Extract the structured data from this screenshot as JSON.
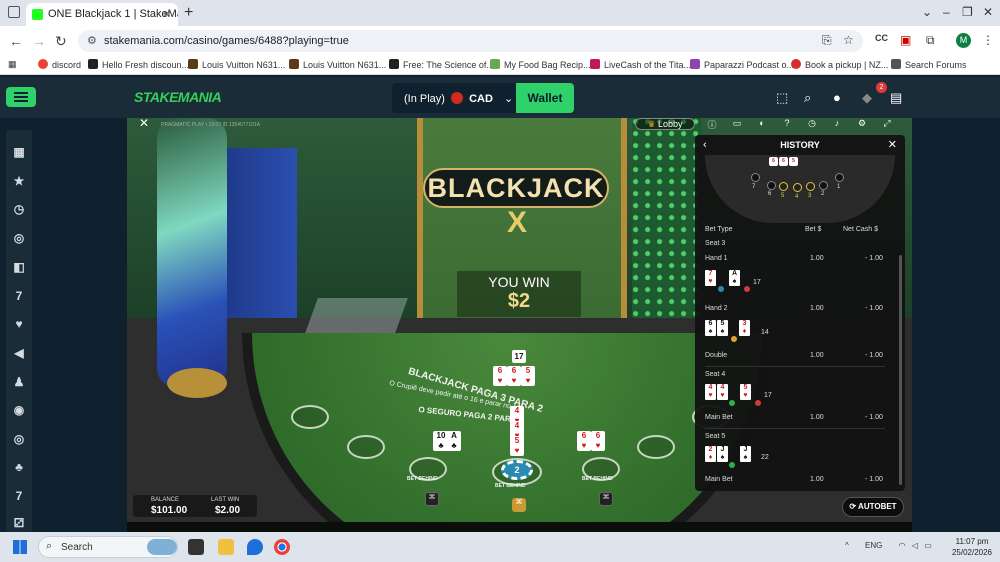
{
  "browser": {
    "tab_title": "ONE Blackjack 1 | StakeMa",
    "tab_close": "×",
    "new_tab": "+",
    "url": "stakemania.com/casino/games/6488?playing=true",
    "profile_initial": "M",
    "window_controls": [
      "⌄",
      "–",
      "❐",
      "✕"
    ]
  },
  "bookmarks": [
    {
      "label": "discord",
      "color": "#ea4335"
    },
    {
      "label": "Hello Fresh discoun...",
      "color": "#222222"
    },
    {
      "label": "Louis Vuitton N631...",
      "color": "#5a3a1a"
    },
    {
      "label": "Louis Vuitton N631...",
      "color": "#5a3a1a"
    },
    {
      "label": "Free: The Science of...",
      "color": "#222222"
    },
    {
      "label": "My Food Bag Recip...",
      "color": "#6aa84f"
    },
    {
      "label": "LiveCash of the Tita...",
      "color": "#c2185b"
    },
    {
      "label": "Paparazzi Podcast o...",
      "color": "#8e44ad"
    },
    {
      "label": "Book a pickup | NZ...",
      "color": "#d32f2f"
    },
    {
      "label": "Search Forums",
      "color": "#555555"
    }
  ],
  "header": {
    "logo": "STAKEMANIA",
    "balance_label": "(In Play)",
    "currency": "CAD",
    "wallet_label": "Wallet",
    "notification_count": "2"
  },
  "sidebar": {
    "items": [
      {
        "icon": "calendar-icon",
        "glyph": "▦"
      },
      {
        "icon": "star-icon",
        "glyph": "★"
      },
      {
        "icon": "history-icon",
        "glyph": "◷"
      },
      {
        "icon": "target-icon",
        "glyph": "◎"
      },
      {
        "icon": "bookmark-icon",
        "glyph": "◧"
      },
      {
        "icon": "seven-icon",
        "glyph": "7"
      },
      {
        "icon": "heart-icon",
        "glyph": "♥"
      },
      {
        "icon": "megaphone-icon",
        "glyph": "◀"
      },
      {
        "icon": "chess-icon",
        "glyph": "♟"
      },
      {
        "icon": "coin-icon",
        "glyph": "◉"
      },
      {
        "icon": "poker-chip-icon",
        "glyph": "◎"
      },
      {
        "icon": "cards-icon",
        "glyph": "♣"
      },
      {
        "icon": "seven-icon",
        "glyph": "7"
      },
      {
        "icon": "dice-icon",
        "glyph": "⚂"
      }
    ]
  },
  "game": {
    "title": "BLACKJACK",
    "title_mark": "X",
    "info": "PRAGMATIC PLAY • 23:07 ID 1354077101A",
    "lobby_label": "Lobby",
    "win_text": "YOU WIN",
    "win_amount": "$2",
    "table_text_1": "BLACKJACK PAGA 3 PARA 2",
    "table_text_2": "O Crupiê deve pedir até o 16 e parar no 17",
    "table_text_3": "O SEGURO PAGA 2 PARA 1",
    "bet_behind": "BET BEHIND",
    "dealer_score": "17",
    "chip_value": "2",
    "balance_label": "BALANCE",
    "balance_value": "$101.00",
    "last_win_label": "LAST WIN",
    "last_win_value": "$2.00"
  },
  "history": {
    "title": "HISTORY",
    "columns": [
      "Bet Type",
      "Bet $",
      "Net Cash $"
    ],
    "seat_numbers": [
      "7",
      "6",
      "5",
      "4",
      "3",
      "2",
      "1"
    ],
    "rows": [
      {
        "seat": "Seat 3",
        "hand": "Hand 1",
        "score": "17",
        "bet": "1.00",
        "net": "- 1.00",
        "cards": [
          [
            "7",
            "♥",
            "r"
          ],
          [
            "A",
            "♠",
            "b"
          ]
        ]
      },
      {
        "seat": "",
        "hand": "Hand 2",
        "score": "14",
        "bet": "1.00",
        "net": "- 1.00",
        "cards": [
          [
            "6",
            "♠",
            "b"
          ],
          [
            "5",
            "♠",
            "b"
          ],
          [
            "3",
            "♦",
            "r"
          ]
        ]
      },
      {
        "seat": "",
        "hand": "Double",
        "score": "",
        "bet": "1.00",
        "net": "- 1.00",
        "cards": []
      },
      {
        "seat": "Seat 4",
        "hand": "Main Bet",
        "score": "17",
        "bet": "1.00",
        "net": "- 1.00",
        "cards": [
          [
            "4",
            "♥",
            "r"
          ],
          [
            "4",
            "♥",
            "r"
          ],
          [
            "5",
            "♥",
            "r"
          ]
        ]
      },
      {
        "seat": "Seat 5",
        "hand": "Main Bet",
        "score": "22",
        "bet": "1.00",
        "net": "- 1.00",
        "cards": [
          [
            "2",
            "♦",
            "r"
          ],
          [
            "J",
            "♠",
            "b"
          ],
          [
            "J",
            "♠",
            "b"
          ]
        ]
      }
    ],
    "autobet_label": "AUTOBET"
  },
  "taskbar": {
    "search_placeholder": "Search",
    "language": "ENG",
    "time": "11:07 pm",
    "date": "25/02/2026"
  }
}
